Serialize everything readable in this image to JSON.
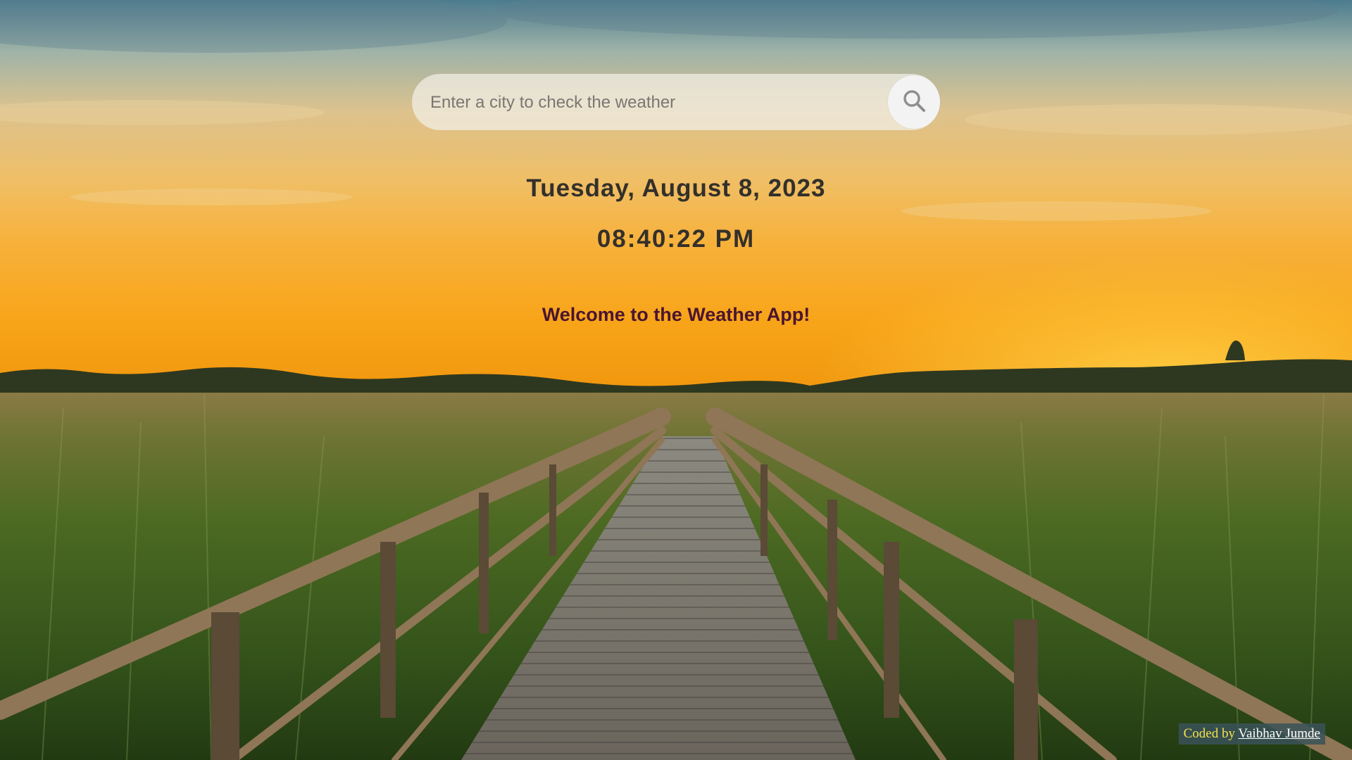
{
  "search": {
    "placeholder": "Enter a city to check the weather",
    "value": "",
    "button_icon": "search-icon"
  },
  "datetime": {
    "date": "Tuesday, August 8, 2023",
    "time": "08:40:22 PM"
  },
  "welcome": {
    "message": "Welcome to the Weather App!"
  },
  "footer": {
    "prefix": "Coded by",
    "author": "Vaibhav Jumde"
  },
  "colors": {
    "sky_top": "#4a7d8f",
    "sky_mid": "#e8c478",
    "horizon": "#f6a51c",
    "grass": "#3d5a1e",
    "welcome_text": "#4a1530",
    "date_text": "#33302b",
    "credit_bg": "#3a5258",
    "credit_prefix": "#f5e24a"
  }
}
